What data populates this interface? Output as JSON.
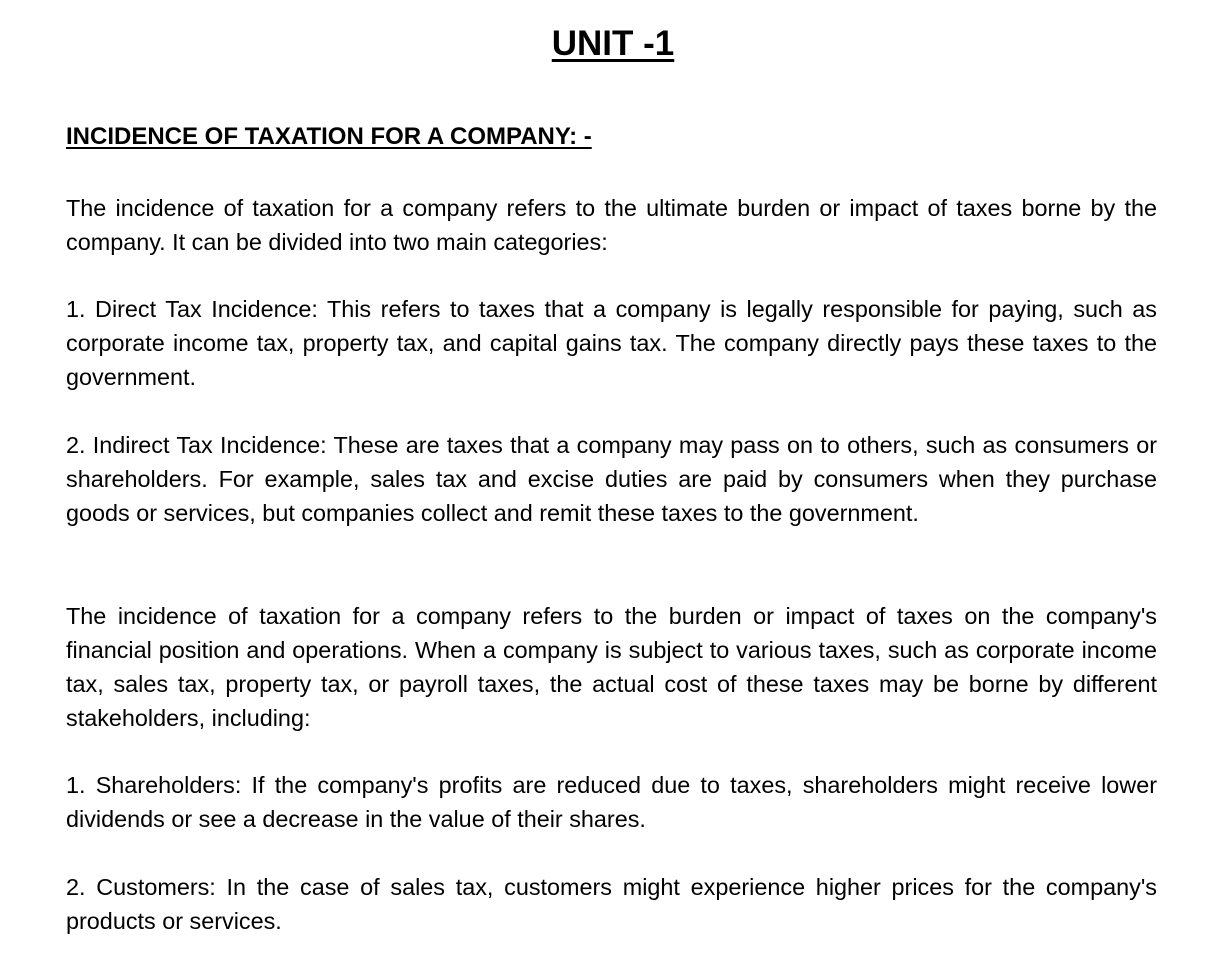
{
  "document": {
    "title": "UNIT -1",
    "heading": "INCIDENCE OF TAXATION FOR A COMPANY: -",
    "paragraphs": [
      "The incidence of taxation for a company refers to the ultimate burden or impact of taxes borne by the company. It can be divided into two main categories:",
      "1. Direct Tax Incidence: This refers to taxes that a company is legally responsible for paying, such as corporate income tax, property tax, and capital gains tax. The company directly pays these taxes to the government.",
      "2. Indirect Tax Incidence: These are taxes that a company may pass on to others, such as consumers or shareholders. For example, sales tax and excise duties are paid by consumers when they purchase goods or services, but companies collect and remit these taxes to the government.",
      "The incidence of taxation for a company refers to the burden or impact of taxes on the company's financial position and operations. When a company is subject to various taxes, such as corporate income tax, sales tax, property tax, or payroll taxes, the actual cost of these taxes may be borne by different stakeholders, including:",
      "1. Shareholders: If the company's profits are reduced due to taxes, shareholders might receive lower dividends or see a decrease in the value of their shares.",
      "2. Customers: In the case of sales tax, customers might experience higher prices for the company's products or services."
    ]
  }
}
